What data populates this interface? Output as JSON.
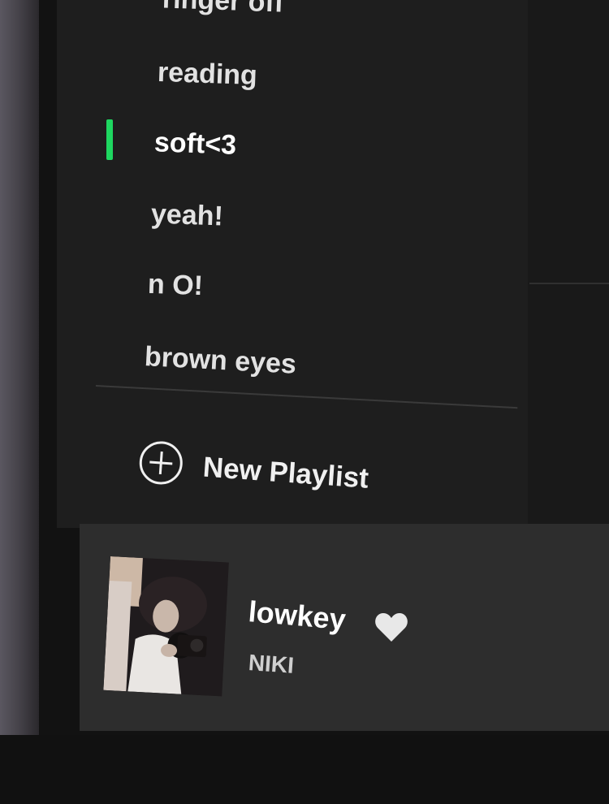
{
  "sidebar": {
    "playlists": [
      {
        "label": "ringer off",
        "active": false
      },
      {
        "label": "reading",
        "active": false
      },
      {
        "label": "soft<3",
        "active": true
      },
      {
        "label": "yeah!",
        "active": false
      },
      {
        "label": "n O!",
        "active": false
      },
      {
        "label": "brown eyes",
        "active": false
      }
    ],
    "new_playlist": {
      "label": "New Playlist",
      "icon": "plus-circle-icon"
    }
  },
  "now_playing": {
    "title": "lowkey",
    "artist": "NIKI",
    "liked": true
  },
  "colors": {
    "accent": "#1ed760",
    "sidebar_bg": "#1e1e1e",
    "now_playing_bg": "#2d2d2d"
  }
}
